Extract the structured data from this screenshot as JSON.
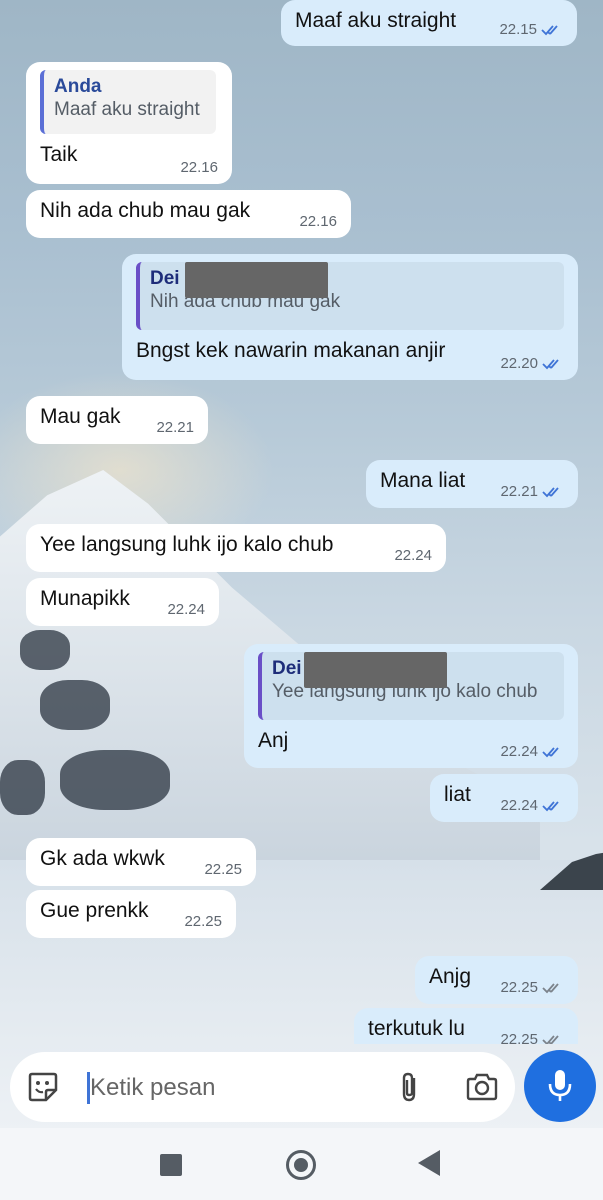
{
  "chat": {
    "messages": [
      {
        "dir": "out",
        "text": "Maaf aku straight",
        "time": "22.15",
        "ticks": "blue"
      },
      {
        "dir": "in",
        "quote_author": "Anda",
        "quote_text": "Maaf aku straight",
        "text": "Taik",
        "time": "22.16"
      },
      {
        "dir": "in",
        "text": "Nih ada chub mau gak",
        "time": "22.16"
      },
      {
        "dir": "out",
        "quote_author": "Dei",
        "quote_text": "Nih ada chub mau gak",
        "text": "Bngst kek nawarin makanan anjir",
        "time": "22.20",
        "ticks": "blue"
      },
      {
        "dir": "in",
        "text": "Mau gak",
        "time": "22.21"
      },
      {
        "dir": "out",
        "text": "Mana liat",
        "time": "22.21",
        "ticks": "blue"
      },
      {
        "dir": "in",
        "text": "Yee langsung luhk ijo kalo chub",
        "time": "22.24"
      },
      {
        "dir": "in",
        "text": "Munapikk",
        "time": "22.24"
      },
      {
        "dir": "out",
        "quote_author": "Dei",
        "quote_text": "Yee langsung luhk ijo kalo chub",
        "text": "Anj",
        "time": "22.24",
        "ticks": "blue"
      },
      {
        "dir": "out",
        "text": "liat",
        "time": "22.24",
        "ticks": "blue"
      },
      {
        "dir": "in",
        "text": "Gk ada wkwk",
        "time": "22.25"
      },
      {
        "dir": "in",
        "text": "Gue prenkk",
        "time": "22.25"
      },
      {
        "dir": "out",
        "text": "Anjg",
        "time": "22.25",
        "ticks": "gray"
      },
      {
        "dir": "out",
        "text": "terkutuk lu",
        "time": "22.25",
        "ticks": "gray"
      }
    ]
  },
  "composer": {
    "placeholder": "Ketik pesan",
    "icons": [
      "sticker-icon",
      "attach-icon",
      "camera-icon",
      "mic-icon"
    ]
  },
  "nav": {
    "icons": [
      "recents-icon",
      "home-icon",
      "back-icon"
    ]
  },
  "colors": {
    "outgoing_bubble": "#d9ecfb",
    "incoming_bubble": "#ffffff",
    "tick_read": "#3f74d6",
    "tick_delivered": "#7c838b",
    "mic_button": "#1f6fe0"
  }
}
